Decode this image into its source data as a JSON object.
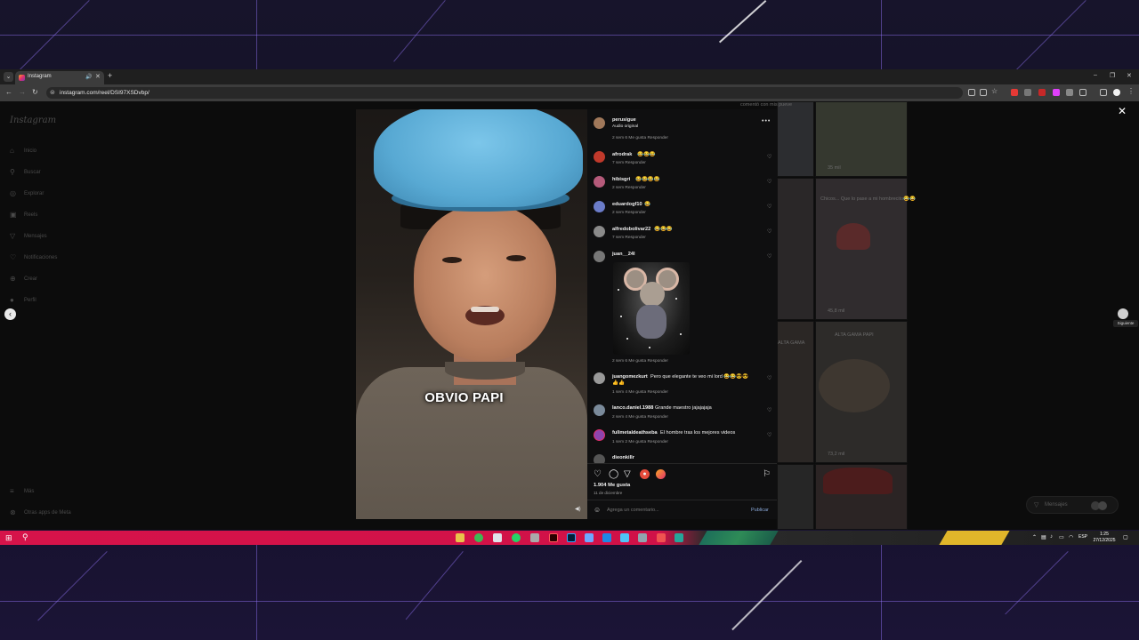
{
  "browser": {
    "tab_title": "Instagram",
    "url": "instagram.com/reel/DSI97XSDvbp/",
    "new_tab_glyph": "+",
    "minimize_glyph": "–",
    "maximize_glyph": "❐",
    "close_glyph": "✕"
  },
  "sidebar": {
    "logo": "Instagram",
    "items": [
      {
        "label": "Inicio",
        "icon": "home-icon"
      },
      {
        "label": "Buscar",
        "icon": "search-icon"
      },
      {
        "label": "Explorar",
        "icon": "compass-icon"
      },
      {
        "label": "Reels",
        "icon": "reels-icon"
      },
      {
        "label": "Mensajes",
        "icon": "send-icon"
      },
      {
        "label": "Notificaciones",
        "icon": "heart-icon"
      },
      {
        "label": "Crear",
        "icon": "plus-icon"
      },
      {
        "label": "Perfil",
        "icon": "avatar-icon"
      }
    ],
    "more": "Más",
    "meta_apps": "Otras apps de Meta"
  },
  "overlay": {
    "next_tooltip": "Siguiente"
  },
  "reel": {
    "caption": "OBVIO PAPI"
  },
  "comments_panel": {
    "author": {
      "username": "perusigue",
      "subtitle": "Audio original",
      "meta": "2 sem   6 Me gusta   Responder"
    },
    "comments": [
      {
        "username": "afrodrak",
        "text": "😂😂😂",
        "meta": "7 sem   Responder",
        "avatar_color": "#c0392b"
      },
      {
        "username": "hibisgri",
        "text": "😂😂😂😂",
        "meta": "2 sem   Responder",
        "avatar_color": "#b55a7a"
      },
      {
        "username": "eduardogf10",
        "text": "😂",
        "meta": "2 sem   Responder",
        "avatar_color": "#6b7cc9"
      },
      {
        "username": "alfredobolivar22",
        "text": "😂😂😂",
        "meta": "7 sem   Responder",
        "avatar_color": "#8a8a8a"
      },
      {
        "username": "juan__24l",
        "text": "",
        "meta": "2 sem   6 Me gusta   Responder",
        "avatar_color": "#777"
      },
      {
        "username": "juangomezkurt",
        "text": "Pero que elegante te veo mi lord 😂😂😎😎",
        "text2": "👍👍",
        "meta": "1 sem   4 Me gusta   Responder",
        "avatar_color": "#999"
      },
      {
        "username": "lanco.daniel.1988",
        "text": "Grande maestro jajajajaja",
        "meta": "2 sem   4 Me gusta   Responder",
        "avatar_color": "#7a8a9a"
      },
      {
        "username": "fullmetaldeathseba",
        "text": "El hombre tras los mejores videos",
        "meta": "1 sem   2 Me gusta   Responder",
        "avatar_color": "#8e44ad"
      },
      {
        "username": "dieonkillr",
        "text": "",
        "meta": "",
        "avatar_color": "#555"
      }
    ],
    "likes": "1.904 Me gusta",
    "date": "11 de diciembre",
    "comment_placeholder": "Agrega un comentario...",
    "post_label": "Publicar"
  },
  "background_grid": {
    "texts": [
      "35 mil",
      "Chicos... Que lo pase a mi hombrecito😂😂",
      "45,8 mil",
      "ALTA GAMA PAPI",
      "73,2 mil",
      "ALTA GAMA",
      "comentó con mis pueve"
    ]
  },
  "messages_pill": {
    "label": "Mensajes"
  },
  "taskbar": {
    "time": "1:25",
    "date": "27/12/2025",
    "lang": "ESP"
  }
}
